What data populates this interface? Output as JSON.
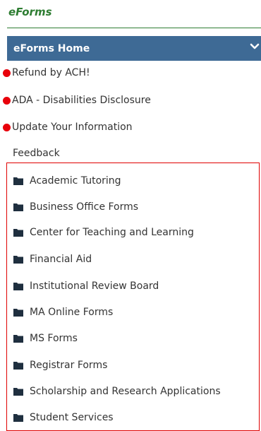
{
  "header": {
    "title": "eForms"
  },
  "nav": {
    "home_label": "eForms Home",
    "links": [
      {
        "label": "Refund by ACH!"
      },
      {
        "label": "ADA - Disabilities Disclosure"
      },
      {
        "label": "Update Your Information"
      }
    ],
    "feedback_label": "Feedback",
    "folders": [
      {
        "label": "Academic Tutoring"
      },
      {
        "label": "Business Office Forms"
      },
      {
        "label": "Center for Teaching and Learning"
      },
      {
        "label": "Financial Aid"
      },
      {
        "label": "Institutional Review Board"
      },
      {
        "label": "MA Online Forms"
      },
      {
        "label": "MS Forms"
      },
      {
        "label": "Registrar Forms"
      },
      {
        "label": "Scholarship and Research Applications"
      },
      {
        "label": "Student Services"
      }
    ]
  },
  "colors": {
    "title_green": "#2e7d32",
    "home_bar_blue": "#3e6a95",
    "dot_red": "#e8000b",
    "highlight_border": "#e00000",
    "folder_icon": "#1f2f3f"
  }
}
